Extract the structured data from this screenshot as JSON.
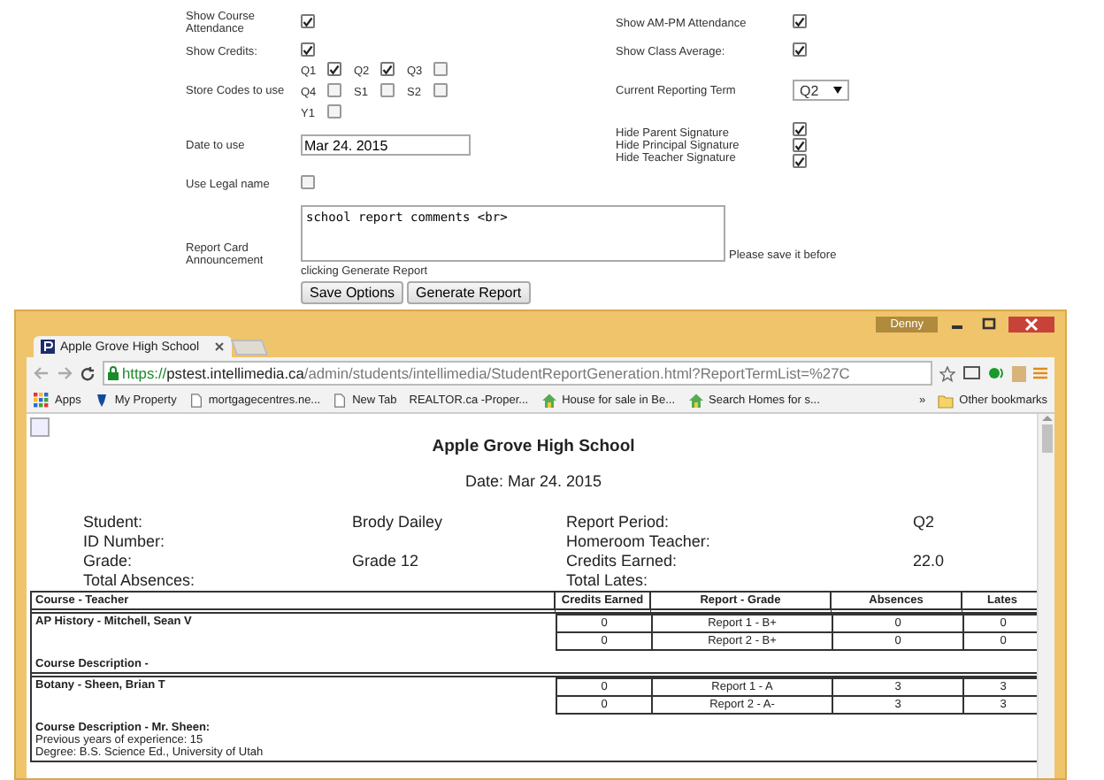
{
  "form": {
    "show_course_attendance": {
      "label": "Show Course Attendance",
      "checked": true
    },
    "show_am_pm_attendance": {
      "label": "Show AM-PM Attendance",
      "checked": true
    },
    "show_credits": {
      "label": "Show Credits:",
      "checked": true
    },
    "show_class_average": {
      "label": "Show Class Average:",
      "checked": true
    },
    "store_codes": {
      "label": "Store Codes to use",
      "codes": [
        {
          "label": "Q1",
          "checked": true
        },
        {
          "label": "Q2",
          "checked": true
        },
        {
          "label": "Q3",
          "checked": false
        },
        {
          "label": "Q4",
          "checked": false
        },
        {
          "label": "S1",
          "checked": false
        },
        {
          "label": "S2",
          "checked": false
        },
        {
          "label": "Y1",
          "checked": false
        }
      ]
    },
    "current_reporting_term": {
      "label": "Current Reporting Term",
      "value": "Q2"
    },
    "date_to_use": {
      "label": "Date to use",
      "value": "Mar 24. 2015"
    },
    "hide_signatures": [
      {
        "label": "Hide Parent Signature",
        "checked": true
      },
      {
        "label": "Hide Principal Signature",
        "checked": true
      },
      {
        "label": "Hide Teacher Signature",
        "checked": true
      }
    ],
    "use_legal_name": {
      "label": "Use Legal name",
      "checked": false
    },
    "announcement": {
      "label": "Report Card Announcement",
      "value": "school report comments <br>",
      "note": "Please save it before",
      "note_continued": "clicking Generate Report"
    },
    "buttons": [
      "Save Options",
      "Generate Report"
    ]
  },
  "browser": {
    "user": "Denny",
    "tab_title": "Apple Grove High School",
    "url": {
      "scheme": "https://",
      "host": "pstest.intellimedia.ca",
      "path": "/admin/students/intellimedia/StudentReportGeneration.html?ReportTermList=%27C"
    },
    "bookmarks": [
      {
        "label": "Apps",
        "kind": "apps"
      },
      {
        "label": "My Property",
        "kind": "pin"
      },
      {
        "label": "mortgagecentres.ne...",
        "kind": "page"
      },
      {
        "label": "New Tab",
        "kind": "page"
      },
      {
        "label": "REALTOR.ca -Proper...",
        "kind": "none"
      },
      {
        "label": "House for sale in Be...",
        "kind": "house"
      },
      {
        "label": "Search Homes for s...",
        "kind": "house"
      }
    ],
    "overflow": "»",
    "other_bookmarks": "Other bookmarks"
  },
  "report": {
    "title": "Apple Grove High School",
    "date": "Date: Mar 24. 2015",
    "info_left": [
      {
        "label": "Student:",
        "value": "Brody Dailey"
      },
      {
        "label": "ID Number:"
      },
      {
        "label": "Grade:",
        "value": "Grade 12"
      },
      {
        "label": "Total Absences:"
      }
    ],
    "info_right": [
      {
        "label": "Report Period:",
        "value": "Q2"
      },
      {
        "label": "Homeroom Teacher:"
      },
      {
        "label": "Credits Earned:",
        "value": "22.0"
      },
      {
        "label": "Total Lates:"
      }
    ],
    "table": {
      "columns": [
        "Course - Teacher",
        "Credits Earned",
        "Report - Grade",
        "Absences",
        "Lates"
      ],
      "courses": [
        {
          "name": "AP History - Mitchell, Sean V",
          "rows": [
            [
              "0",
              "Report 1 - B+",
              "0",
              "0"
            ],
            [
              "0",
              "Report 2 - B+",
              "0",
              "0"
            ]
          ],
          "description": "Course Description -"
        },
        {
          "name": "Botany - Sheen, Brian T",
          "rows": [
            [
              "0",
              "Report 1 - A",
              "3",
              "3"
            ],
            [
              "0",
              "Report 2 - A-",
              "3",
              "3"
            ]
          ],
          "description": "Course Description - Mr. Sheen:",
          "details": [
            "Previous years of experience: 15",
            "Degree: B.S. Science Ed., University of Utah"
          ]
        }
      ]
    }
  }
}
